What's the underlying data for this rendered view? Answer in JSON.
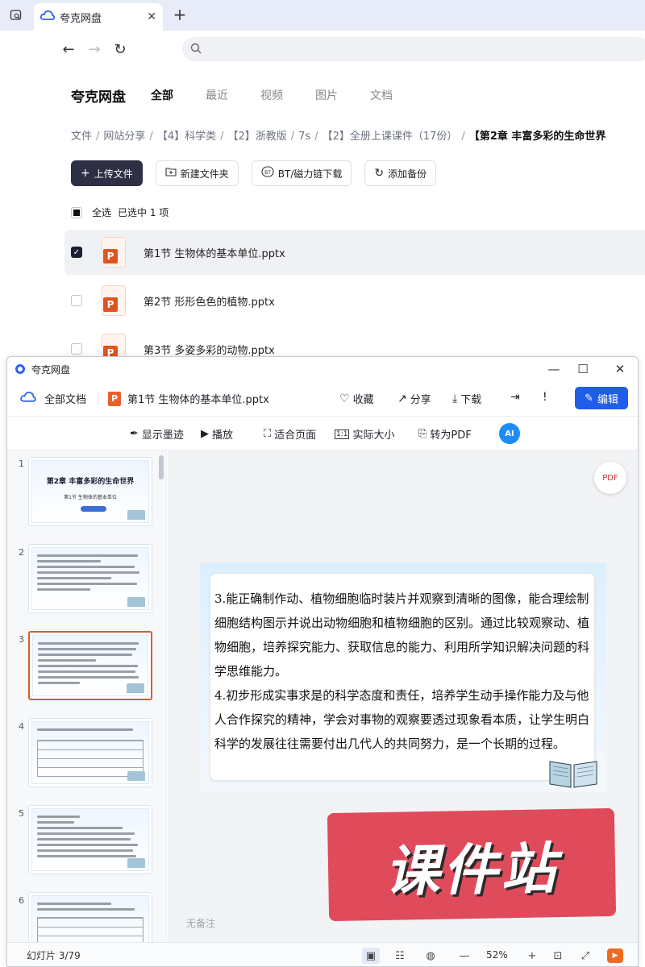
{
  "browser": {
    "tab_title": "夸克网盘",
    "tab_close": "✕",
    "new_tab": "+",
    "back": "←",
    "forward": "→",
    "reload": "↻",
    "address_icon": "search-icon"
  },
  "app": {
    "logo": "夸克网盘",
    "nav": [
      "全部",
      "最近",
      "视频",
      "图片",
      "文档"
    ],
    "breadcrumb": [
      "文件",
      "网站分享",
      "【4】科学类",
      "【2】浙教版",
      "7s",
      "【2】全册上课课件（17份）",
      "【第2章 丰富多彩的生命世界"
    ],
    "actions": {
      "upload": "上传文件",
      "new_folder": "新建文件夹",
      "bt_download": "BT/磁力链下载",
      "add_backup": "添加备份"
    },
    "select_all": "全选",
    "selected_count": "已选中 1 项",
    "files": [
      {
        "name": "第1节 生物体的基本单位.pptx",
        "selected": true
      },
      {
        "name": "第2节 形形色色的植物.pptx",
        "selected": false
      },
      {
        "name": "第3节 多姿多彩的动物.pptx",
        "selected": false
      }
    ]
  },
  "viewer": {
    "window_title": "夸克网盘",
    "all_docs": "全部文档",
    "doc_badge": "P",
    "doc_name": "第1节 生物体的基本单位.pptx",
    "favorite": "收藏",
    "share": "分享",
    "download": "下载",
    "edit": "编辑",
    "show_ink": "显示墨迹",
    "play": "播放",
    "fit_page": "适合页面",
    "actual_size": "实际大小",
    "to_pdf": "转为PDF",
    "ai": "AI",
    "pdf_float": "PDF",
    "thumbnails": [
      {
        "num": "1",
        "title": "第2章  丰富多彩的生命世界",
        "subtitle": "第1节  生物体的基本单位"
      },
      {
        "num": "2"
      },
      {
        "num": "3"
      },
      {
        "num": "4"
      },
      {
        "num": "5"
      },
      {
        "num": "6"
      }
    ],
    "slide_paragraphs": [
      "3.能正确制作动、植物细胞临时装片并观察到清晰的图像，能合理绘制细胞结构图示并说出动物细胞和植物细胞的区别。通过比较观察动、植物细胞，培养探究能力、获取信息的能力、利用所学知识解决问题的科学思维能力。",
      "4.初步形成实事求是的科学态度和责任，培养学生动手操作能力及与他人合作探究的精神，学会对事物的观察要透过现象看本质，让学生明白科学的发展往往需要付出几代人的共同努力，是一个长期的过程。"
    ],
    "no_notes": "无备注",
    "watermark": "课件站",
    "slide_status": "幻灯片 3/79",
    "zoom": "52%"
  }
}
